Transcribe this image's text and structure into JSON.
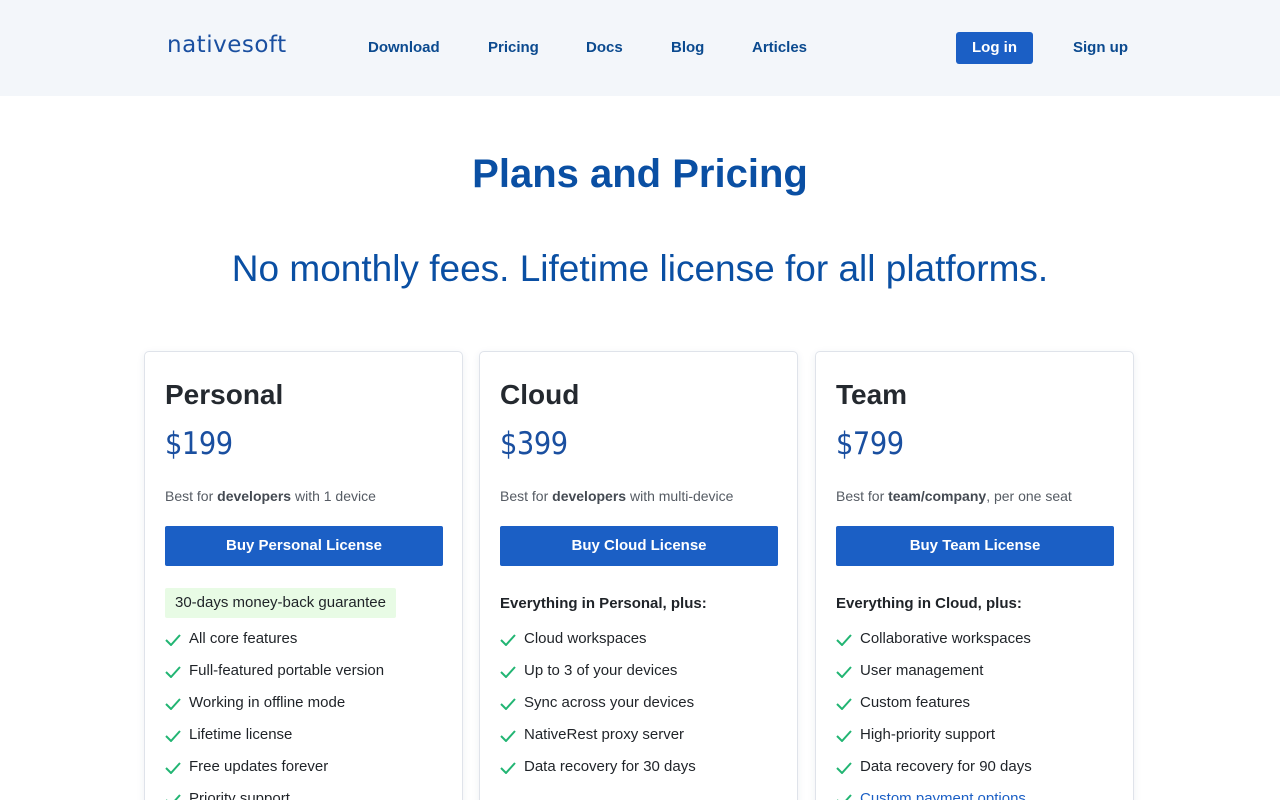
{
  "header": {
    "logo": "nativesoft",
    "nav": [
      "Download",
      "Pricing",
      "Docs",
      "Blog",
      "Articles"
    ],
    "login": "Log in",
    "signup": "Sign up"
  },
  "page_title": "Plans and Pricing",
  "subtitle": "No monthly fees. Lifetime license for all platforms.",
  "plans": [
    {
      "name": "Personal",
      "price": "$199",
      "best_prefix": "Best for ",
      "best_bold": "developers",
      "best_suffix": " with 1 device",
      "button": "Buy Personal License",
      "guarantee": "30-days money-back guarantee",
      "features": [
        "All core features",
        "Full-featured portable version",
        "Working in offline mode",
        "Lifetime license",
        "Free updates forever",
        "Priority support"
      ]
    },
    {
      "name": "Cloud",
      "price": "$399",
      "best_prefix": "Best for ",
      "best_bold": "developers",
      "best_suffix": " with multi-device",
      "button": "Buy Cloud License",
      "everything": "Everything in Personal, plus:",
      "features": [
        "Cloud workspaces",
        "Up to 3 of your devices",
        "Sync across your devices",
        "NativeRest proxy server",
        "Data recovery for 30 days"
      ]
    },
    {
      "name": "Team",
      "price": "$799",
      "best_prefix": "Best for ",
      "best_bold": "team/company",
      "best_suffix": ", per one seat",
      "button": "Buy Team License",
      "everything": "Everything in Cloud, plus:",
      "features": [
        "Collaborative workspaces",
        "User management",
        "Custom features",
        "High-priority support",
        "Data recovery for 90 days",
        "Custom payment options"
      ]
    }
  ],
  "colors": {
    "accent": "#1b5fc5",
    "heading": "#0a4fa3",
    "check": "#22b573",
    "guarantee_bg": "#e8fbe5"
  }
}
